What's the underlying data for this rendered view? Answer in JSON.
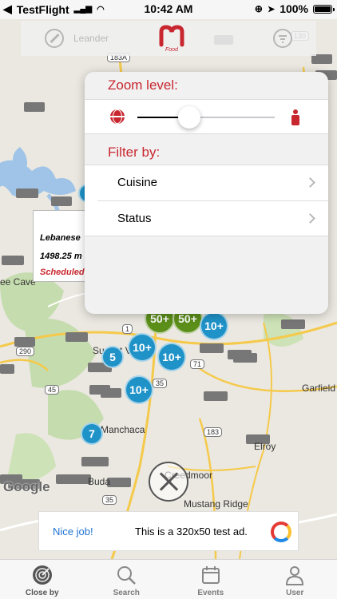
{
  "status_bar": {
    "carrier": "TestFlight",
    "time": "10:42 AM",
    "battery": "100%"
  },
  "top_bar": {
    "city": "Leander",
    "logo_text": "Food"
  },
  "popover": {
    "zoom_heading": "Zoom level:",
    "zoom_value": 0.38,
    "filter_heading": "Filter by:",
    "filters": [
      {
        "label": "Cuisine"
      },
      {
        "label": "Status"
      }
    ]
  },
  "callout": {
    "name": "Lebanese",
    "distance": "1498.25 m",
    "status": "Scheduled"
  },
  "clusters": [
    {
      "label": "10+",
      "color": "blue"
    },
    {
      "label": "50+",
      "color": "green"
    },
    {
      "label": "50+",
      "color": "green"
    },
    {
      "label": "10+",
      "color": "blue"
    },
    {
      "label": "5",
      "color": "blue"
    },
    {
      "label": "10+",
      "color": "blue"
    },
    {
      "label": "10+",
      "color": "blue"
    },
    {
      "label": "10+",
      "color": "blue"
    },
    {
      "label": "7",
      "color": "blue"
    }
  ],
  "map_labels": {
    "lee_cave": "ee Cave",
    "sunset_valley": "Sunset V",
    "garfield": "Garfield",
    "elroy": "Elroy",
    "buda": "Buda",
    "manchaca": "Manchaca",
    "creedmoor": "Creedmoor",
    "mustang_ridge": "Mustang Ridge",
    "google": "Google",
    "route_183a": "183A",
    "route_290": "290",
    "route_45": "45",
    "route_1": "1",
    "route_71": "71",
    "route_35": "35",
    "route_183": "183",
    "route_35b": "35",
    "route_130": "130"
  },
  "ad": {
    "nice": "Nice job!",
    "text": "This is a 320x50 test ad."
  },
  "tabs": [
    {
      "label": "Close by",
      "icon": "radar-icon"
    },
    {
      "label": "Search",
      "icon": "search-icon"
    },
    {
      "label": "Events",
      "icon": "calendar-icon"
    },
    {
      "label": "User",
      "icon": "user-icon"
    }
  ],
  "colors": {
    "accent": "#c8272f",
    "cluster_blue": "#1f92c8",
    "cluster_green": "#5c8f1a",
    "link": "#1f74d2"
  }
}
